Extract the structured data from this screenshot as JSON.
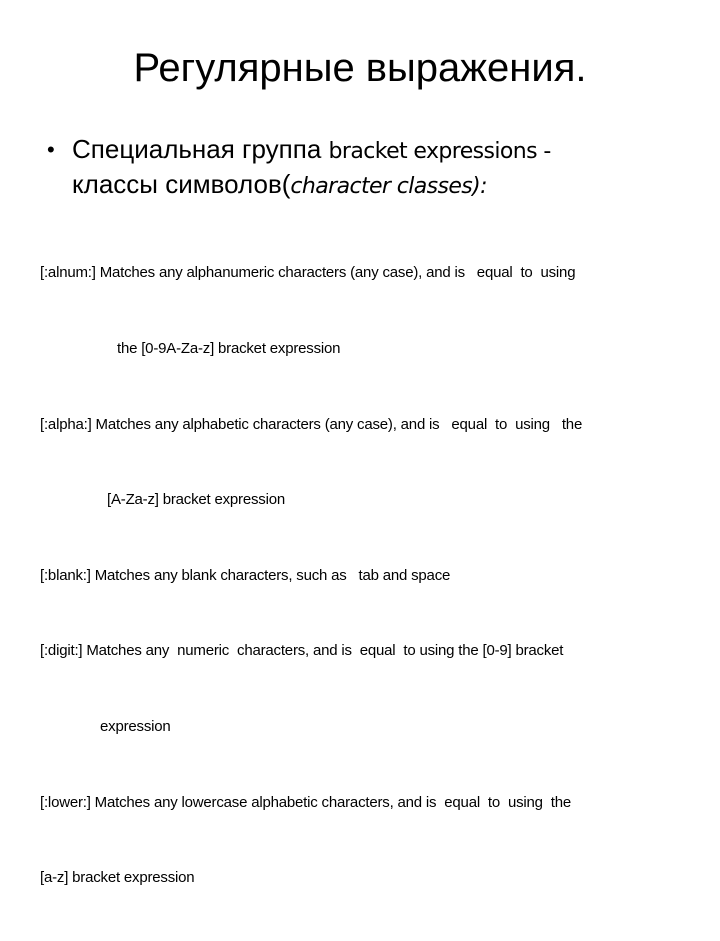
{
  "slide": {
    "title": "Регулярные выражения.",
    "bullet": {
      "marker": "•",
      "text_ru": "Специальная группа ",
      "text_en": "bracket expressions -",
      "line2_ru": "классы символов(",
      "line2_en_italic": "character classes):"
    },
    "definitions": [
      {
        "line1": "[:alnum:] Matches any alphanumeric characters (any case), and is   equal  to  using",
        "line2": "the [0-9A-Za-z] bracket expression"
      },
      {
        "line1": "[:alpha:] Matches any alphabetic characters (any case), and is   equal  to  using   the",
        "line2": "[A-Za-z] bracket expression"
      },
      {
        "line1": "[:blank:] Matches any blank characters, such as   tab and space"
      },
      {
        "line1": "[:digit:] Matches any  numeric  characters, and is  equal  to using the [0-9] bracket",
        "line2": "expression"
      },
      {
        "line1": "[:lower:] Matches any lowercase alphabetic characters, and is  equal  to  using  the",
        "line2": "[a-z] bracket expression"
      }
    ]
  }
}
